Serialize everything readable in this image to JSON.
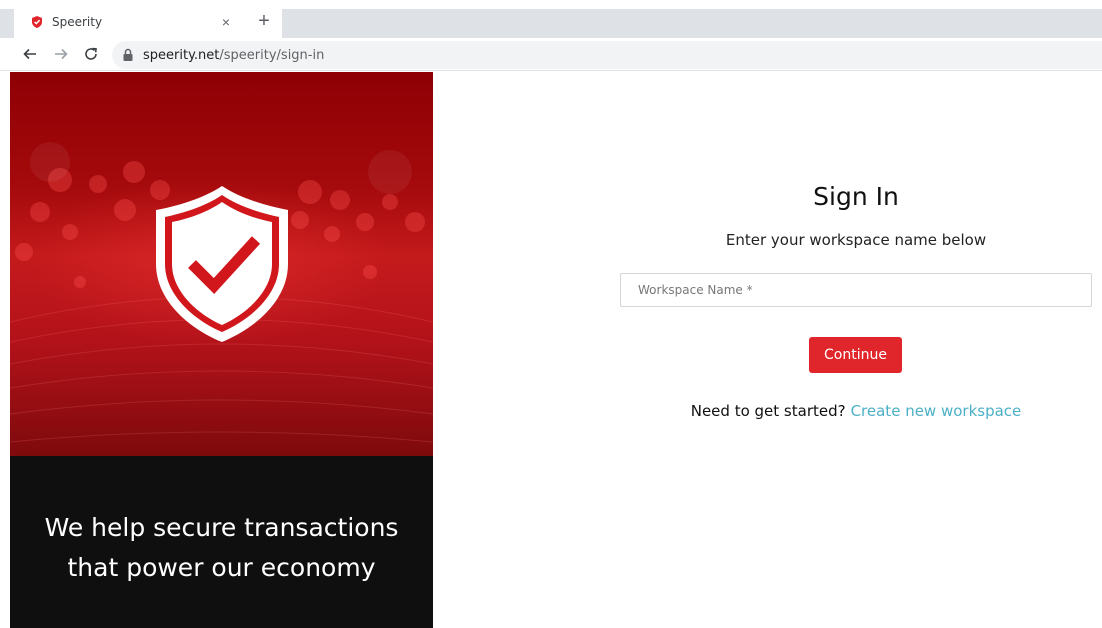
{
  "browser": {
    "tab_title": "Speerity",
    "url_host": "speerity.net",
    "url_path": "/speerity/sign-in",
    "tab_close_glyph": "×",
    "new_tab_glyph": "+"
  },
  "hero": {
    "tagline": "We help secure transactions that power our economy",
    "icon": "shield-check-icon"
  },
  "signin": {
    "title": "Sign In",
    "subtitle": "Enter your workspace name below",
    "workspace_placeholder": "Workspace Name *",
    "workspace_value": "",
    "continue_label": "Continue",
    "prompt": "Need to get started?",
    "create_link": "Create new workspace"
  },
  "colors": {
    "brand_red": "#e1262b",
    "link_teal": "#4cb0c6",
    "hero_dark": "#0f0f0f"
  }
}
